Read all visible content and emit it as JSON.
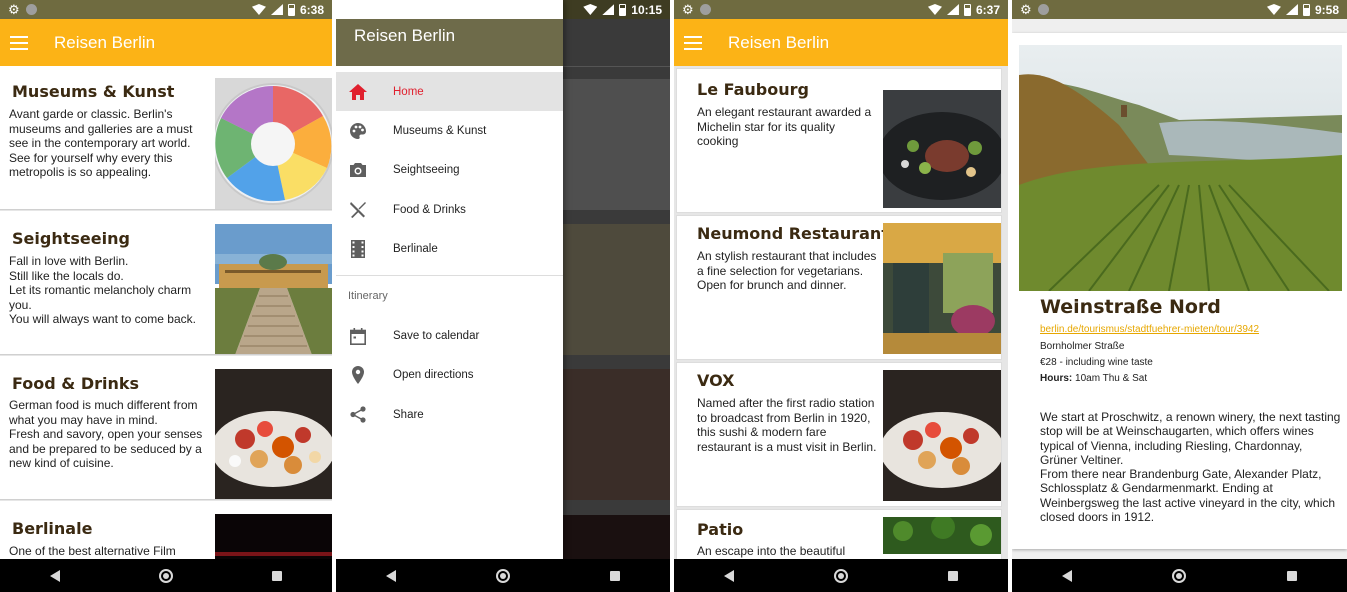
{
  "colors": {
    "appbar": "#fcb316",
    "statusbar": "#6f6b40",
    "drawer_header": "#6e6b4a",
    "title_brown": "#3b2a12",
    "active_red": "#e0202e",
    "link": "#e7a700"
  },
  "app_title": "Reisen Berlin",
  "screen1": {
    "time": "6:38",
    "cards": [
      {
        "title": "Museums & Kunst",
        "desc": "Avant garde or classic. Berlin's museums and galleries are a must see in the contemporary art world. See for yourself why every this metropolis is so appealing.",
        "image": "color-wheel-art"
      },
      {
        "title": "Seightseeing",
        "desc": "Fall in love with Berlin.\nStill like the locals do.\nLet its romantic melancholy charm you.\nYou will always want to come back.",
        "image": "palace-stairs"
      },
      {
        "title": "Food & Drinks",
        "desc": "German food is much different from what you may have in mind.\nFresh and savory, open your senses and be prepared to be seduced by a new kind of cuisine.",
        "image": "food-plate"
      },
      {
        "title": "Berlinale",
        "desc": "One of the best alternative Film",
        "image": "film-festival"
      }
    ]
  },
  "screen2": {
    "time": "10:15",
    "drawer": {
      "items": [
        {
          "label": "Home",
          "icon": "home-icon",
          "active": true
        },
        {
          "label": "Museums & Kunst",
          "icon": "palette-icon",
          "active": false
        },
        {
          "label": "Seightseeing",
          "icon": "camera-icon",
          "active": false
        },
        {
          "label": "Food & Drinks",
          "icon": "utensils-icon",
          "active": false
        },
        {
          "label": "Berlinale",
          "icon": "film-icon",
          "active": false
        }
      ],
      "section": "Itinerary",
      "actions": [
        {
          "label": "Save to calendar",
          "icon": "calendar-icon"
        },
        {
          "label": "Open directions",
          "icon": "location-pin-icon"
        },
        {
          "label": "Share",
          "icon": "share-icon"
        }
      ]
    }
  },
  "screen3": {
    "time": "6:37",
    "cards": [
      {
        "title": "Le Faubourg",
        "desc": "An elegant restaurant awarded a Michelin star for its quality cooking",
        "image": "dish-plate"
      },
      {
        "title": "Neumond Restaurant",
        "desc": "An stylish restaurant that includes a fine selection for vegetarians. Open for brunch and dinner.",
        "image": "restaurant-interior"
      },
      {
        "title": "VOX",
        "desc": "Named after the first radio station to broadcast from Berlin in 1920, this sushi & modern fare restaurant is a must visit in Berlin.",
        "image": "food-plate"
      },
      {
        "title": "Patio",
        "desc": "An escape into the beautiful",
        "image": "green-patio"
      }
    ]
  },
  "screen4": {
    "time": "9:58",
    "title": "Weinstraße Nord",
    "link": "berlin.de/tourismus/stadtfuehrer-mieten/tour/3942",
    "address": "Bornholmer Straße",
    "price": "€28 - including wine taste",
    "hours_label": "Hours:",
    "hours_value": "10am Thu & Sat",
    "body": "We start at Proschwitz, a renown winery, the next tasting stop will be at Weinschaugarten, which offers wines typical of Vienna, including Riesling, Chardonnay, Grüner Veltiner.\nFrom there near Brandenburg Gate, Alexander Platz, Schlossplatz & Gendarmenmarkt. Ending at Weinbergsweg the last active vineyard in the city, which closed doors in 1912."
  }
}
